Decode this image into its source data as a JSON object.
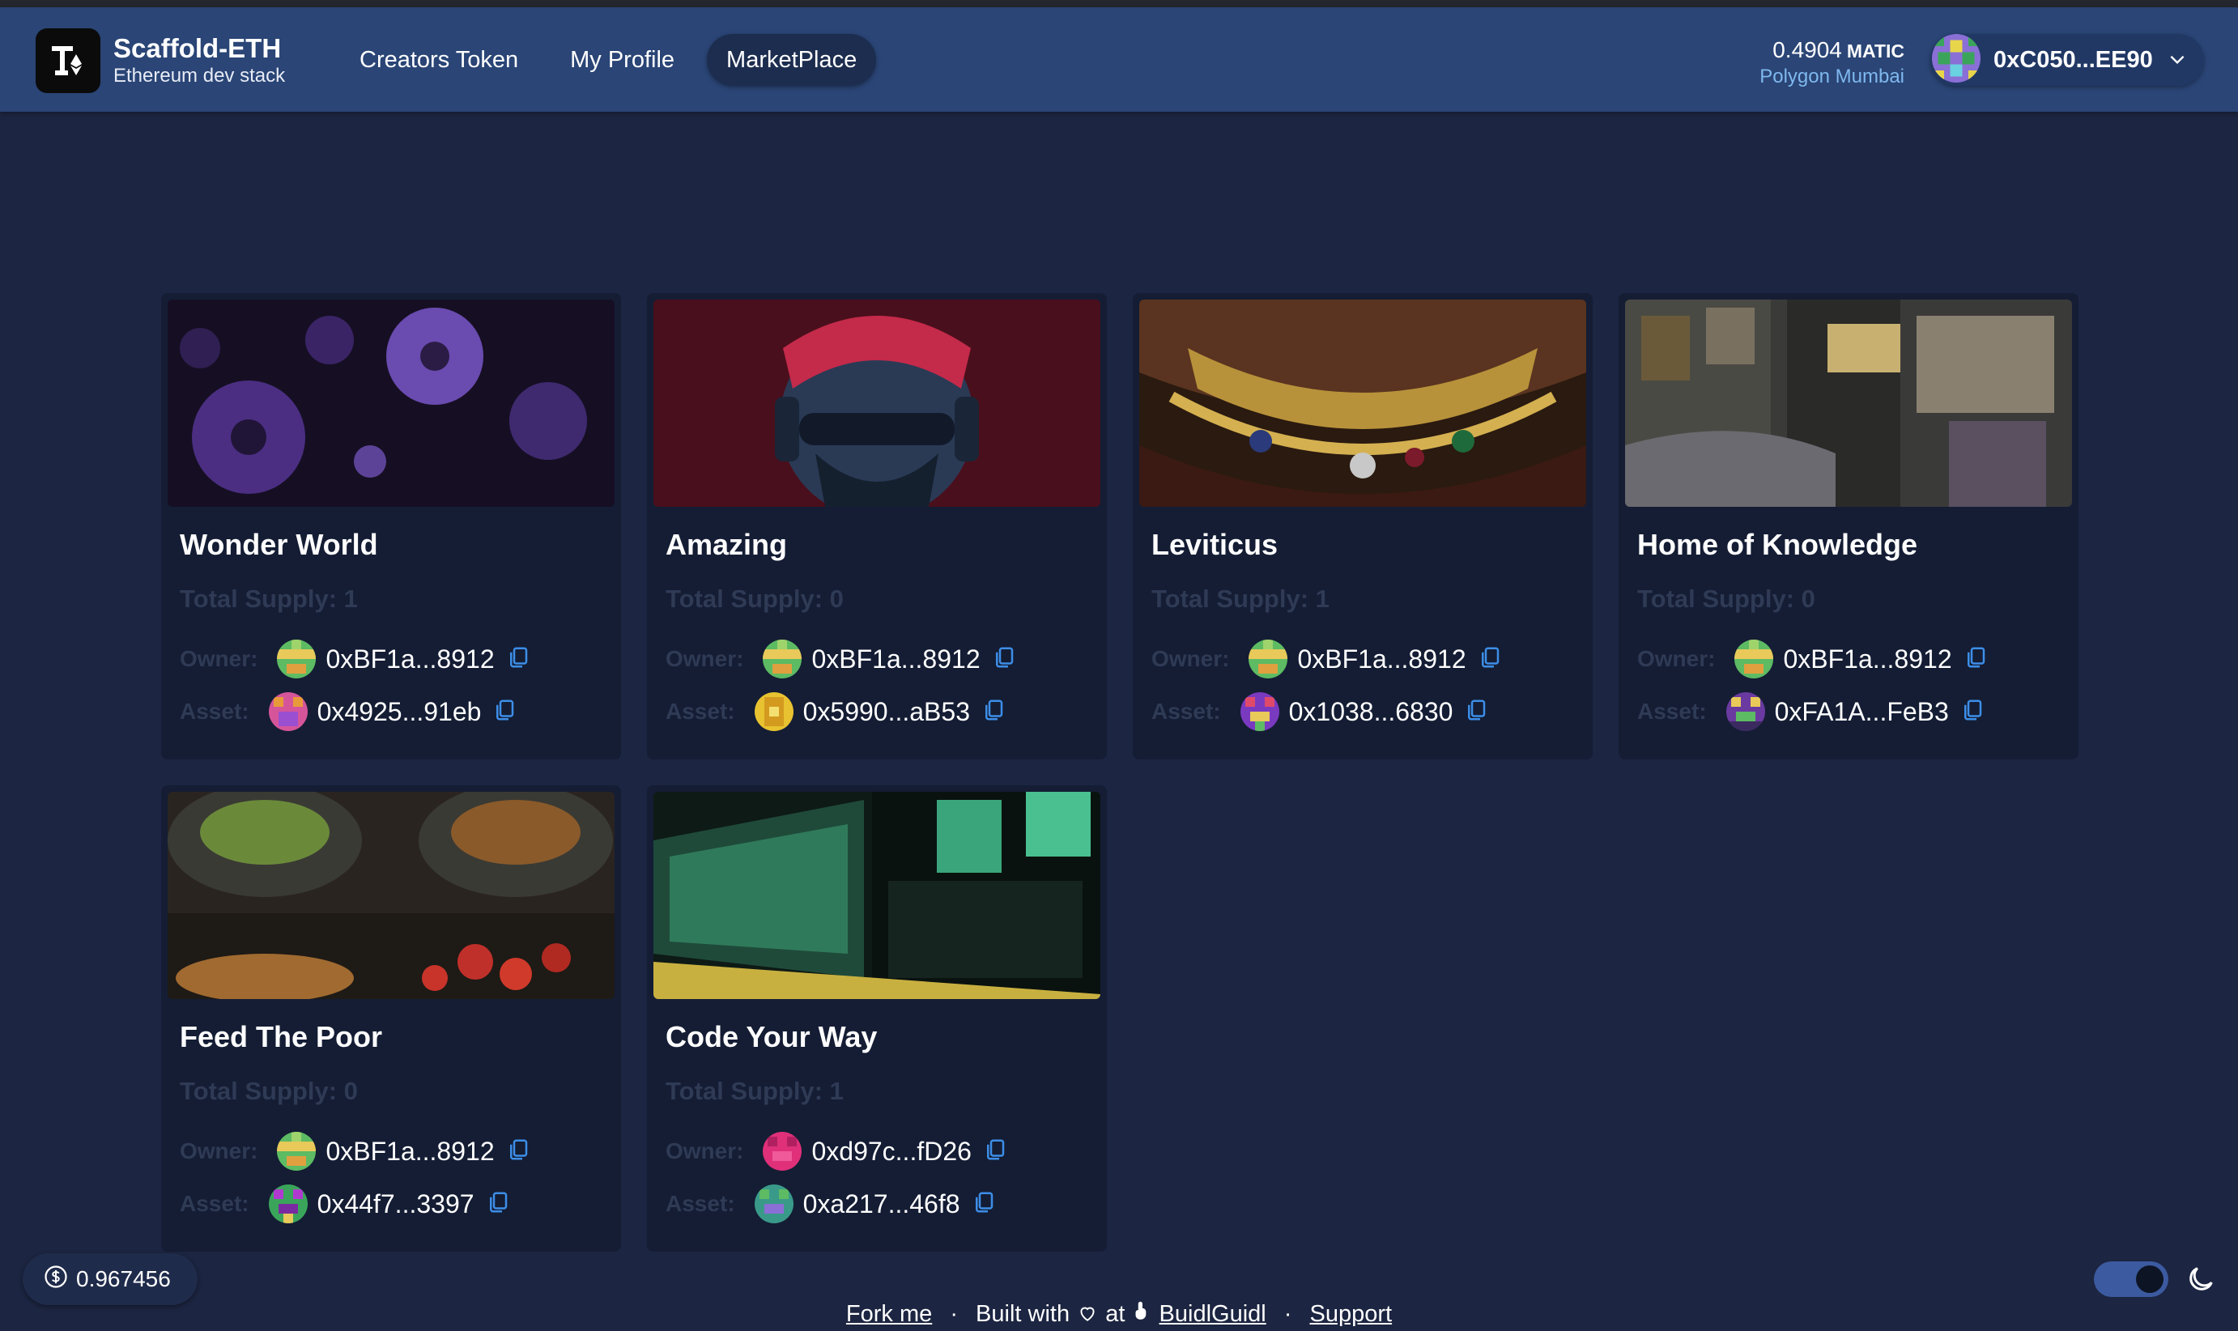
{
  "brand": {
    "title": "Scaffold-ETH",
    "subtitle": "Ethereum dev stack"
  },
  "nav": {
    "items": [
      "Creators Token",
      "My Profile",
      "MarketPlace"
    ],
    "active": "MarketPlace"
  },
  "wallet": {
    "balance": "0.4904",
    "symbol": "MATIC",
    "network": "Polygon Mumbai",
    "address": "0xC050...EE90"
  },
  "labels": {
    "owner": "Owner:",
    "asset": "Asset:"
  },
  "cards": [
    {
      "title": "Wonder World",
      "supply": "Total Supply: 1",
      "owner": "0xBF1a...8912",
      "asset": "0x4925...91eb"
    },
    {
      "title": "Amazing",
      "supply": "Total Supply: 0",
      "owner": "0xBF1a...8912",
      "asset": "0x5990...aB53"
    },
    {
      "title": "Leviticus",
      "supply": "Total Supply: 1",
      "owner": "0xBF1a...8912",
      "asset": "0x1038...6830"
    },
    {
      "title": "Home of Knowledge",
      "supply": "Total Supply: 0",
      "owner": "0xBF1a...8912",
      "asset": "0xFA1A...FeB3"
    },
    {
      "title": "Feed The Poor",
      "supply": "Total Supply: 0",
      "owner": "0xBF1a...8912",
      "asset": "0x44f7...3397"
    },
    {
      "title": "Code Your Way",
      "supply": "Total Supply: 1",
      "owner": "0xd97c...fD26",
      "asset": "0xa217...46f8"
    }
  ],
  "faucet": {
    "value": "0.967456"
  },
  "footer": {
    "fork": "Fork me",
    "built": "Built with",
    "at": "at",
    "buidlguidl": "BuidlGuidl",
    "support": "Support"
  },
  "colors": {
    "background": "#1c2541",
    "navbar": "#2a4576",
    "card": "#141d34",
    "accent_link": "#7fb8ee",
    "muted": "#2f3a55"
  },
  "icons": [
    "copy-icon",
    "chevron-down-icon",
    "heart-icon",
    "moon-icon",
    "dollar-icon",
    "hand-icon"
  ]
}
